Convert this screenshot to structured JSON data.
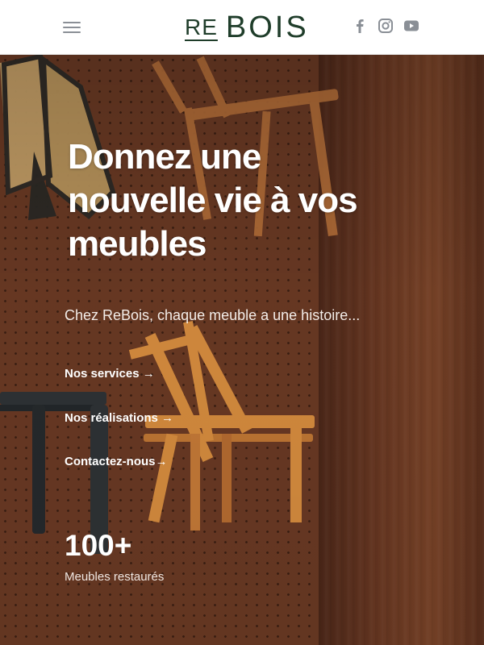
{
  "header": {
    "logo_re": "RE",
    "logo_bois": "BOIS",
    "social": [
      {
        "name": "facebook",
        "icon": "facebook-icon"
      },
      {
        "name": "instagram",
        "icon": "instagram-icon"
      },
      {
        "name": "youtube",
        "icon": "youtube-icon"
      }
    ]
  },
  "hero": {
    "title_line1": "Donnez une",
    "title_line2": "nouvelle vie à vos",
    "title_line3": "meubles",
    "subtitle": "Chez ReBois, chaque meuble a une histoire...",
    "links": [
      {
        "label": "Nos services →"
      },
      {
        "label": "Nos réalisations →"
      },
      {
        "label": "Contactez-nous→"
      }
    ],
    "stat_value": "100+",
    "stat_label": "Meubles restaurés"
  },
  "colors": {
    "brand_green": "#1f3d2a",
    "icon_grey": "#8a8f96",
    "wood_dark": "#5a2f1c",
    "wood_light": "#d9893a"
  }
}
